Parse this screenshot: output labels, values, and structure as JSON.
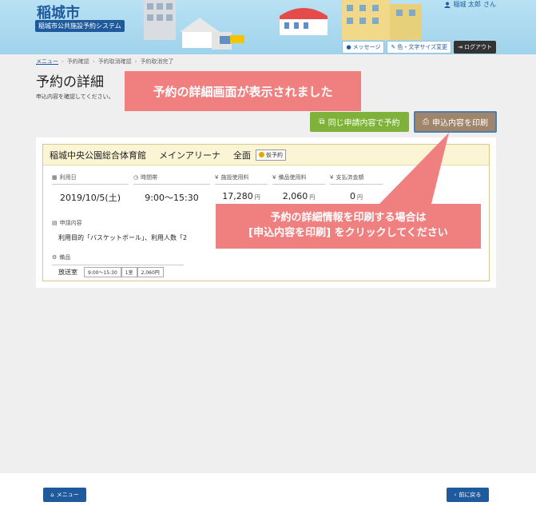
{
  "header": {
    "city_title": "稲城市",
    "system_name": "稲城市公共施設予約システム",
    "user_name": "稲城 太郎",
    "user_suffix": "さん",
    "buttons": {
      "message": "メッセージ",
      "color_font": "色・文字サイズ変更",
      "logout": "ログアウト"
    }
  },
  "breadcrumb": {
    "items": [
      "メニュー",
      "予約確認",
      "予約取消確認",
      "予約取消完了"
    ],
    "separator": "›"
  },
  "page": {
    "title": "予約の詳細",
    "description": "申込内容を確認してください。"
  },
  "actions": {
    "same_request": "同じ申請内容で予約",
    "print": "申込内容を印刷"
  },
  "reservation": {
    "facility": "稲城中央公園総合体育館",
    "room": "メインアリーナ",
    "area": "全面",
    "status_badge": "仮予約",
    "fields": [
      {
        "label": "利用日",
        "value": "2019/10/5(土)",
        "unit": ""
      },
      {
        "label": "時間帯",
        "value": "9:00〜15:30",
        "unit": ""
      },
      {
        "label": "施設使用料",
        "value": "17,280",
        "unit": "円"
      },
      {
        "label": "備品使用料",
        "value": "2,060",
        "unit": "円"
      },
      {
        "label": "支払済金額",
        "value": "0",
        "unit": "円"
      }
    ],
    "application_label": "申請内容",
    "application_text": "利用目的「バスケットボール」、利用人数「2",
    "equipment_label": "備品",
    "equipment_name": "放送室",
    "equipment_tags": [
      "9:00〜15:30",
      "1室",
      "2,060円"
    ]
  },
  "callouts": {
    "top": "予約の詳細画面が表示されました",
    "bottom_line1": "予約の詳細情報を印刷する場合は",
    "bottom_line2": "[申込内容を印刷] をクリックしてください"
  },
  "footer": {
    "menu": "メニュー",
    "back": "前に戻る"
  },
  "colors": {
    "brand_blue": "#1e5a9c",
    "callout_pink": "#f08080",
    "green_button": "#7fb23a",
    "print_button": "#a0856b"
  }
}
